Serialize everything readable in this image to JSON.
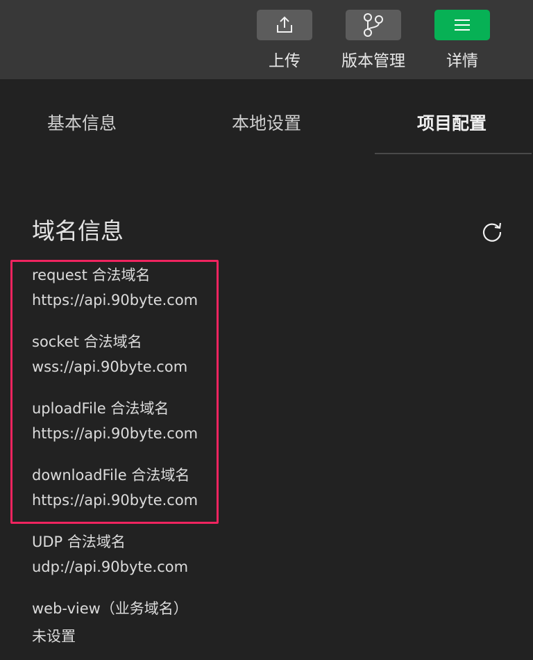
{
  "toolbar": {
    "upload": {
      "label": "上传",
      "icon": "upload-icon"
    },
    "version": {
      "label": "版本管理",
      "icon": "branch-icon"
    },
    "details": {
      "label": "详情",
      "icon": "menu-icon",
      "color": "#07b155"
    }
  },
  "tabs": [
    {
      "label": "基本信息"
    },
    {
      "label": "本地设置"
    },
    {
      "label": "项目配置",
      "active": true
    }
  ],
  "section": {
    "title": "域名信息",
    "refresh_icon": "refresh-icon"
  },
  "domains": [
    {
      "label": "request 合法域名",
      "value": "https://api.90byte.com"
    },
    {
      "label": "socket 合法域名",
      "value": "wss://api.90byte.com"
    },
    {
      "label": "uploadFile 合法域名",
      "value": "https://api.90byte.com"
    },
    {
      "label": "downloadFile 合法域名",
      "value": "https://api.90byte.com"
    },
    {
      "label": "UDP 合法域名",
      "value": "udp://api.90byte.com"
    },
    {
      "label": "web-view（业务域名）",
      "value": "未设置"
    }
  ],
  "colors": {
    "highlight": "#f0245f",
    "background": "#222222",
    "toolbar": "#383838"
  }
}
